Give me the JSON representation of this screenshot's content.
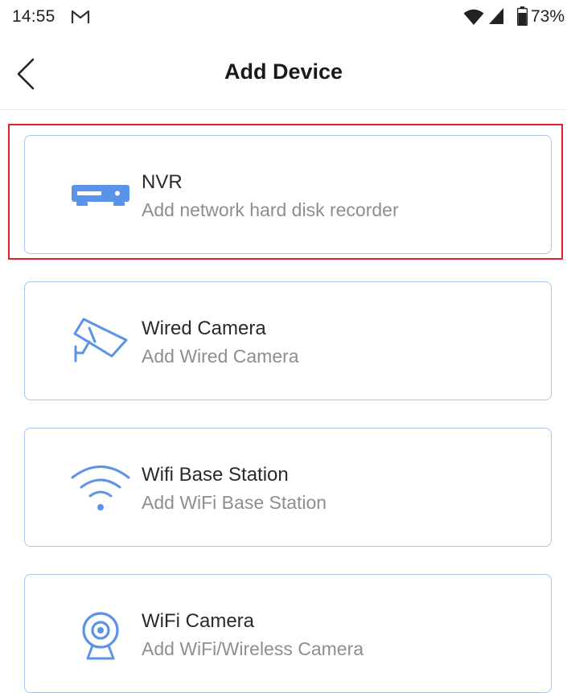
{
  "status_bar": {
    "time": "14:55",
    "battery": "73%",
    "icons": [
      "gmail-icon",
      "wifi-icon",
      "cellular-signal-icon",
      "battery-icon"
    ]
  },
  "header": {
    "title": "Add Device",
    "back_icon": "chevron-left-icon"
  },
  "colors": {
    "accent": "#5b93e8",
    "card_border": "#a9c6ec",
    "highlight": "#e0232b",
    "title_text": "#2a2a2a",
    "subtitle_text": "#8e8e8e"
  },
  "devices": [
    {
      "title": "NVR",
      "subtitle": "Add network hard disk recorder",
      "icon": "nvr-recorder-icon",
      "highlighted": true
    },
    {
      "title": "Wired Camera",
      "subtitle": "Add Wired Camera",
      "icon": "wired-camera-icon",
      "highlighted": false
    },
    {
      "title": "Wifi Base Station",
      "subtitle": "Add WiFi Base Station",
      "icon": "wifi-base-station-icon",
      "highlighted": false
    },
    {
      "title": "WiFi Camera",
      "subtitle": "Add WiFi/Wireless Camera",
      "icon": "wifi-camera-icon",
      "highlighted": false
    }
  ]
}
